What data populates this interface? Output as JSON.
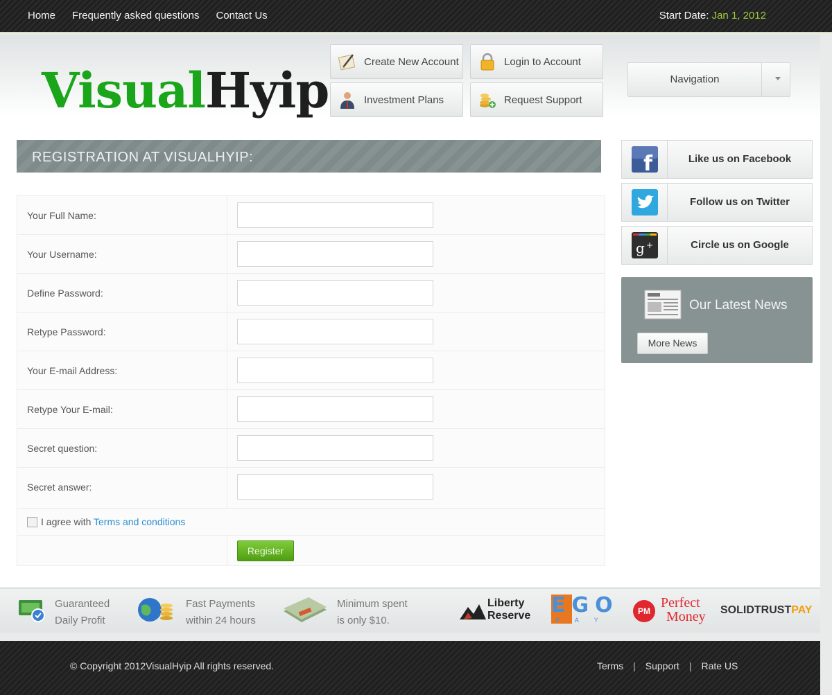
{
  "topbar": {
    "nav": [
      "Home",
      "Frequently asked questions",
      "Contact Us"
    ],
    "start_date_label": "Start Date:",
    "start_date_value": "Jan 1, 2012"
  },
  "logo": {
    "part1": "Visual",
    "part2": "Hyip"
  },
  "quick_buttons": {
    "create_account": "Create New Account",
    "login": "Login to Account",
    "investment_plans": "Investment Plans",
    "request_support": "Request Support"
  },
  "navigation": {
    "label": "Navigation"
  },
  "registration": {
    "title": "REGISTRATION AT VISUALHYIP:",
    "fields": [
      {
        "label": "Your Full Name:",
        "value": ""
      },
      {
        "label": "Your Username:",
        "value": ""
      },
      {
        "label": "Define Password:",
        "value": ""
      },
      {
        "label": "Retype Password:",
        "value": ""
      },
      {
        "label": "Your E-mail Address:",
        "value": ""
      },
      {
        "label": "Retype Your E-mail:",
        "value": ""
      },
      {
        "label": "Secret question:",
        "value": ""
      },
      {
        "label": "Secret answer:",
        "value": ""
      }
    ],
    "agree_text": "I agree with",
    "terms_link": "Terms and conditions",
    "register_label": "Register"
  },
  "social": {
    "facebook": "Like us on Facebook",
    "twitter": "Follow us on Twitter",
    "google": "Circle us on Google"
  },
  "news": {
    "title": "Our Latest News",
    "more_label": "More News"
  },
  "features": [
    {
      "line1": "Guaranteed",
      "line2": "Daily Profit"
    },
    {
      "line1": "Fast Payments",
      "line2": "within 24 hours"
    },
    {
      "line1": "Minimum spent",
      "line2": "is only $10."
    }
  ],
  "payment_logos": {
    "liberty_1": "Liberty",
    "liberty_2": "Reserve",
    "egopay_big": "EGO",
    "egopay_small": "P A Y",
    "perfect_1": "Perfect",
    "perfect_2": "Money",
    "perfect_badge": "PM",
    "solid_1": "SOLIDTRUST",
    "solid_2": "PAY"
  },
  "footer": {
    "copyright": "© Copyright 2012VisualHyip All rights reserved.",
    "links": [
      "Terms",
      "Support",
      "Rate US"
    ]
  },
  "colors": {
    "accent_green": "#1aa51a",
    "date_green": "#9ccc3c",
    "link_blue": "#2a8fd0",
    "header_gray": "#879293"
  }
}
